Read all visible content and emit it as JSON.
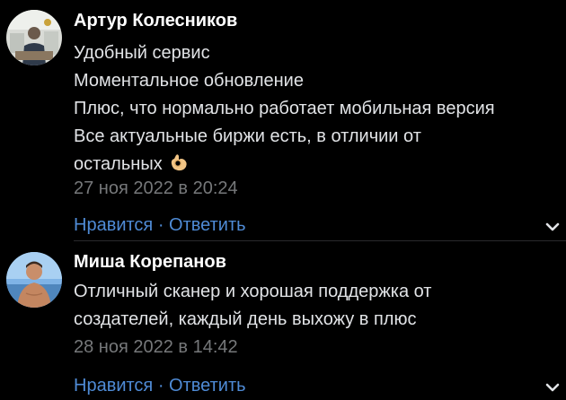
{
  "comments": [
    {
      "author": "Артур Колесников",
      "lines": [
        "Удобный сервис",
        "Моментальное обновление",
        "Плюс, что нормально работает мобильная версия",
        "Все актуальные биржи есть, в отличии от",
        "остальных"
      ],
      "emoji": "ok-hand-icon",
      "date": "27 ноя 2022 в 20:24",
      "like_label": "Нравится",
      "separator": " · ",
      "reply_label": "Ответить"
    },
    {
      "author": "Миша Корепанов",
      "lines": [
        "Отличный сканер и хорошая поддержка от",
        "создателей, каждый день выхожу в плюс"
      ],
      "date": "28 ноя 2022 в 14:42",
      "like_label": "Нравится",
      "separator": " · ",
      "reply_label": "Ответить"
    }
  ],
  "colors": {
    "background": "#000000",
    "text": "#e1e3e6",
    "author": "#ffffff",
    "date": "#76787a",
    "link": "#4f8bd6"
  }
}
